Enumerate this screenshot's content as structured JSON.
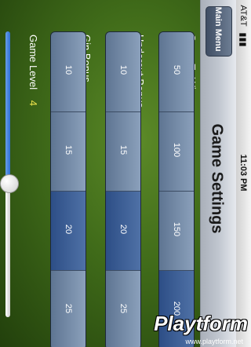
{
  "status_bar": {
    "carrier": "AT&T",
    "time": "11:03 PM"
  },
  "nav": {
    "title": "Game Settings",
    "back_button": "Main Menu"
  },
  "settings": [
    {
      "label": "Score To Win",
      "options": [
        "50",
        "100",
        "150",
        "200"
      ],
      "selected_index": 3
    },
    {
      "label": "Undercut Bonus",
      "options": [
        "10",
        "15",
        "20",
        "25"
      ],
      "selected_index": 2
    },
    {
      "label": "Gin Bonus",
      "options": [
        "10",
        "15",
        "20",
        "25"
      ],
      "selected_index": 2
    }
  ],
  "game_level": {
    "label": "Game Level",
    "value": "4",
    "fraction": 0.48
  },
  "watermark": {
    "brand": "Playtform",
    "url": "www.playtform.net"
  },
  "colors": {
    "background": "#3f6a19",
    "selected_segment": "#3a5c94",
    "segment": "#768ba8"
  }
}
